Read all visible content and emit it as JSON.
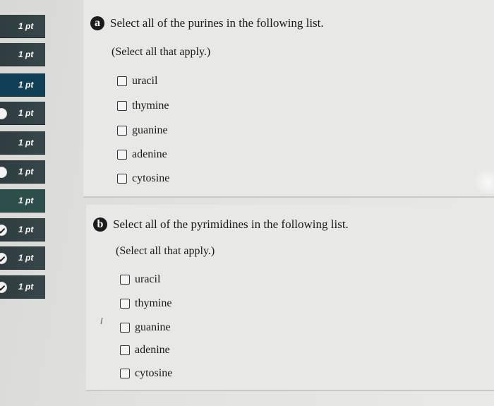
{
  "sidebar": {
    "items": [
      {
        "label": "1 pt",
        "mark": "none"
      },
      {
        "label": "1 pt",
        "mark": "none"
      },
      {
        "label": "1 pt",
        "mark": "none"
      },
      {
        "label": "1 pt",
        "mark": "partial"
      },
      {
        "label": "1 pt",
        "mark": "none"
      },
      {
        "label": "1 pt",
        "mark": "partial"
      },
      {
        "label": "1 pt",
        "mark": "none"
      },
      {
        "label": "1 pt",
        "mark": "check"
      },
      {
        "label": "1 pt",
        "mark": "check"
      },
      {
        "label": "1 pt",
        "mark": "check"
      }
    ]
  },
  "question_a": {
    "badge": "a",
    "text": "Select all of the purines in the following list.",
    "hint": "(Select all that apply.)",
    "options": [
      "uracil",
      "thymine",
      "guanine",
      "adenine",
      "cytosine"
    ]
  },
  "question_b": {
    "badge": "b",
    "text": "Select all of the pyrimidines in the following list.",
    "hint": "(Select all that apply.)",
    "options": [
      "uracil",
      "thymine",
      "guanine",
      "adenine",
      "cytosine"
    ]
  },
  "stray_mark": "I"
}
